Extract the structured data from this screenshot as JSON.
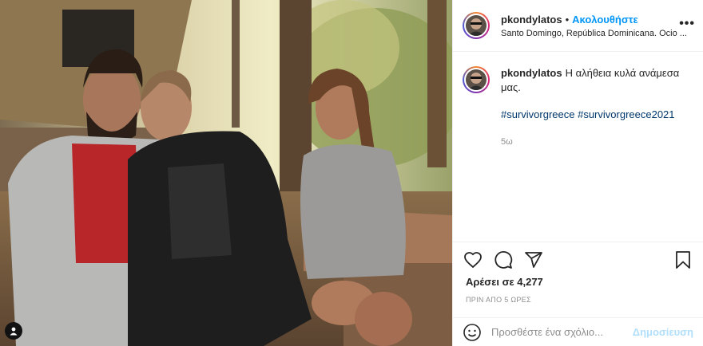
{
  "post": {
    "username": "pkondylatos",
    "follow_label": "Ακολουθήστε",
    "location": "Santo Domingo, República Dominicana. Ocio ...",
    "more_label": "•••",
    "caption_text": "Η αλήθεια κυλά ανάμεσα μας.",
    "hashtags": "#survivorgreece #survivorgreece2021",
    "age": "5ω",
    "likes": "Αρέσει σε 4,277",
    "time_ago": "ΠΡΙΝ ΑΠΟ 5 ΩΡΕΣ"
  },
  "comment": {
    "placeholder": "Προσθέστε ένα σχόλιο...",
    "publish_label": "Δημοσίευση"
  },
  "icons": [
    "heart-icon",
    "comment-icon",
    "share-icon",
    "bookmark-icon",
    "emoji-icon",
    "user-tag-icon"
  ],
  "colors": {
    "link": "#0095f6",
    "hashtag": "#00376b",
    "muted": "#8e8e8e",
    "publish_disabled": "#b2dffc"
  }
}
